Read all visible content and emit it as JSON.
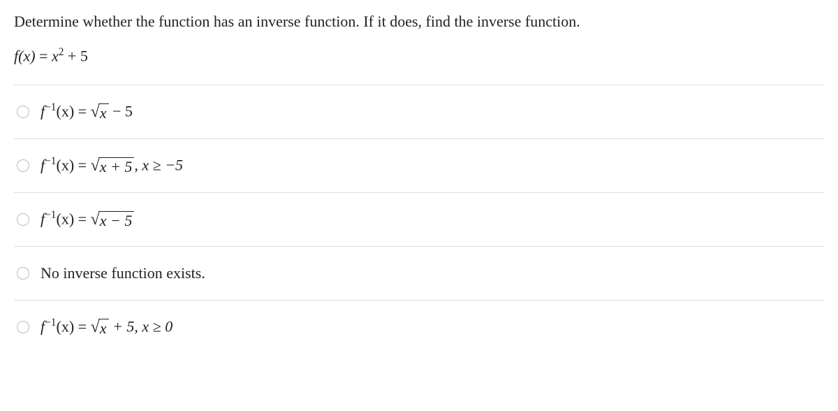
{
  "question": "Determine whether the function has an inverse function. If it does, find the inverse function.",
  "function_lhs": "f(x)",
  "function_rhs_a": "x",
  "function_rhs_exp": "2",
  "function_rhs_b": " + 5",
  "finv_label": "f",
  "finv_exp": "−1",
  "finv_arg": "(x) = ",
  "opt1_radicand": "x",
  "opt1_tail": " − 5",
  "opt2_radicand": "x + 5",
  "opt2_tail": ", x ≥ −5",
  "opt3_radicand": "x − 5",
  "opt4_text": "No inverse function exists.",
  "opt5_radicand": "x",
  "opt5_tail": " + 5, x ≥ 0"
}
